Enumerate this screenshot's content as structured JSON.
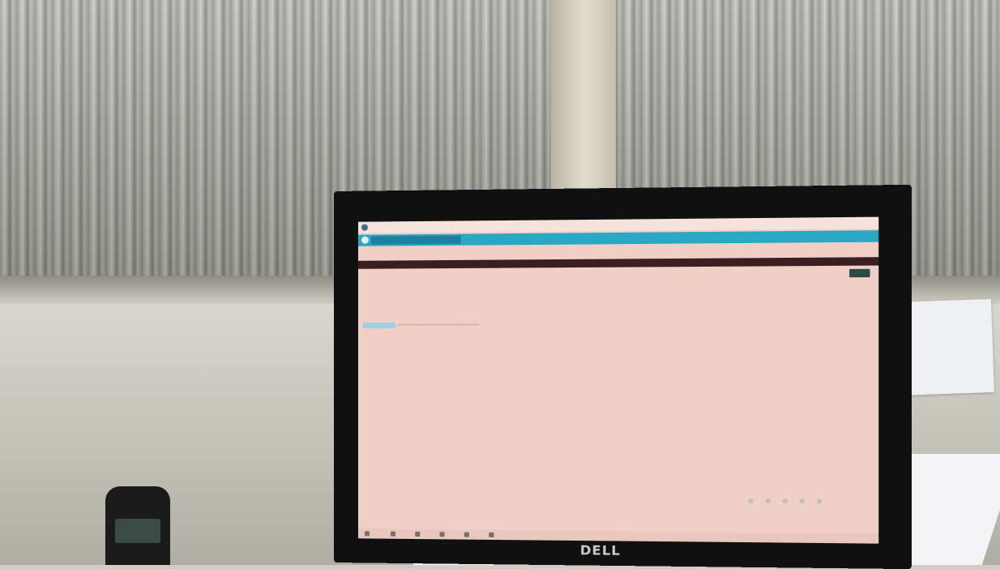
{
  "scene": {
    "description_labels": {
      "window_title": "",
      "tab_label": "",
      "breadcrumb": "",
      "page_title": "",
      "brand": "DELL"
    }
  },
  "app": {
    "tabs": [
      {
        "label": ""
      }
    ],
    "filters": [
      "",
      ""
    ],
    "columns": [
      "",
      "",
      "",
      "",
      "",
      ""
    ]
  },
  "colors": {
    "tabbar": "#2aa7c2",
    "screen_background": "#f0cfc7",
    "header_strip": "#3a1f20"
  }
}
